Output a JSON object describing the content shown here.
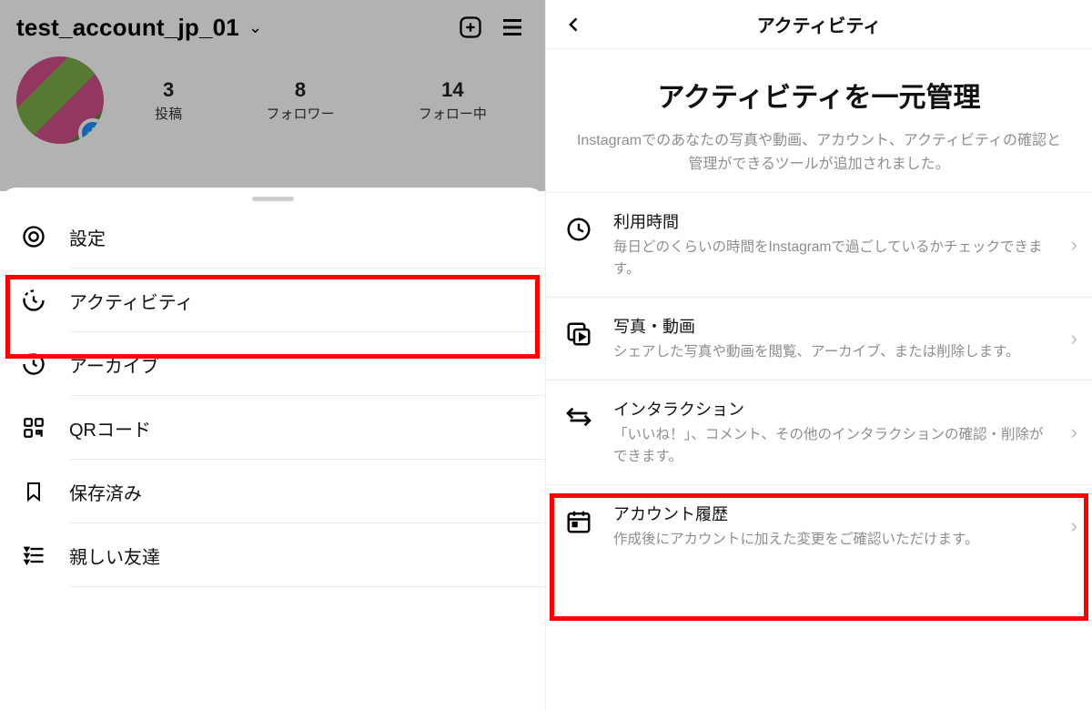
{
  "left": {
    "username": "test_account_jp_01",
    "stats": [
      {
        "n": "3",
        "l": "投稿"
      },
      {
        "n": "8",
        "l": "フォロワー"
      },
      {
        "n": "14",
        "l": "フォロー中"
      }
    ],
    "menu": [
      {
        "label": "設定"
      },
      {
        "label": "アクティビティ"
      },
      {
        "label": "アーカイブ"
      },
      {
        "label": "QRコード"
      },
      {
        "label": "保存済み"
      },
      {
        "label": "親しい友達"
      }
    ]
  },
  "right": {
    "header": "アクティビティ",
    "hero_title": "アクティビティを一元管理",
    "hero_body": "Instagramでのあなたの写真や動画、アカウント、アクティビティの確認と管理ができるツールが追加されました。",
    "items": [
      {
        "title": "利用時間",
        "body": "毎日どのくらいの時間をInstagramで過ごしているかチェックできます。"
      },
      {
        "title": "写真・動画",
        "body": "シェアした写真や動画を閲覧、アーカイブ、または削除します。"
      },
      {
        "title": "インタラクション",
        "body": "「いいね！」、コメント、その他のインタラクションの確認・削除ができます。"
      },
      {
        "title": "アカウント履歴",
        "body": "作成後にアカウントに加えた変更をご確認いただけます。"
      }
    ]
  }
}
